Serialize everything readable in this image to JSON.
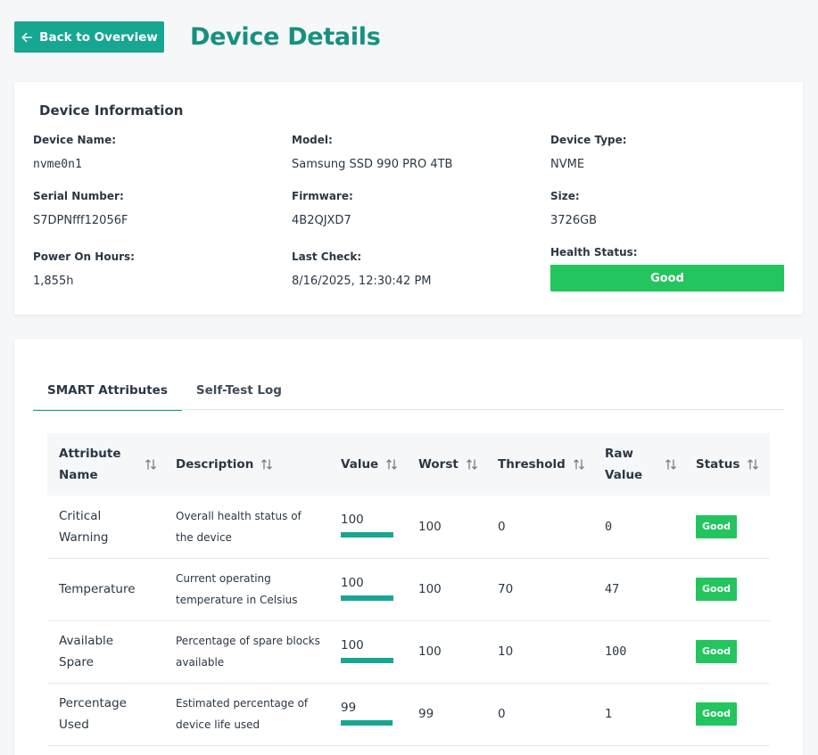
{
  "header": {
    "back_label": "Back to Overview",
    "title": "Device Details"
  },
  "device_info": {
    "heading": "Device Information",
    "fields": {
      "device_name": {
        "label": "Device Name:",
        "value": "nvme0n1"
      },
      "model": {
        "label": "Model:",
        "value": "Samsung SSD 990 PRO 4TB"
      },
      "device_type": {
        "label": "Device Type:",
        "value": "NVME"
      },
      "serial_number": {
        "label": "Serial Number:",
        "value": "S7DPNfff12056F"
      },
      "firmware": {
        "label": "Firmware:",
        "value": "4B2QJXD7"
      },
      "size": {
        "label": "Size:",
        "value": "3726GB"
      },
      "power_on_hours": {
        "label": "Power On Hours:",
        "value": "1,855h"
      },
      "last_check": {
        "label": "Last Check:",
        "value": "8/16/2025, 12:30:42 PM"
      },
      "health_status": {
        "label": "Health Status:",
        "value": "Good"
      }
    }
  },
  "tabs": [
    {
      "label": "SMART Attributes",
      "active": true
    },
    {
      "label": "Self-Test Log",
      "active": false
    }
  ],
  "table": {
    "columns": {
      "attribute_name": "Attribute Name",
      "description": "Description",
      "value": "Value",
      "worst": "Worst",
      "threshold": "Threshold",
      "raw_value": "Raw Value",
      "status": "Status"
    },
    "rows": [
      {
        "name": "Critical Warning",
        "description": "Overall health status of the device",
        "value": "100",
        "value_fraction": 1.0,
        "worst": "100",
        "threshold": "0",
        "raw": "0",
        "status": "Good"
      },
      {
        "name": "Temperature",
        "description": "Current operating temperature in Celsius",
        "value": "100",
        "value_fraction": 1.0,
        "worst": "100",
        "threshold": "70",
        "raw": "47",
        "status": "Good"
      },
      {
        "name": "Available Spare",
        "description": "Percentage of spare blocks available",
        "value": "100",
        "value_fraction": 1.0,
        "worst": "100",
        "threshold": "10",
        "raw": "100",
        "status": "Good"
      },
      {
        "name": "Percentage Used",
        "description": "Estimated percentage of device life used",
        "value": "99",
        "value_fraction": 0.99,
        "worst": "99",
        "threshold": "0",
        "raw": "1",
        "status": "Good"
      }
    ]
  },
  "colors": {
    "accent": "#17a691",
    "good": "#22c55e"
  }
}
